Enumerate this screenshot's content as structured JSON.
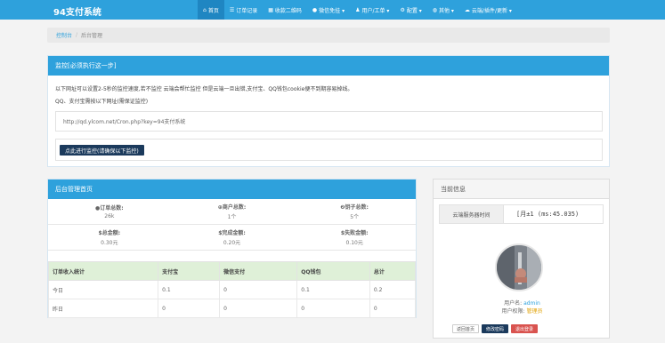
{
  "app": {
    "title": "94支付系统"
  },
  "nav": [
    {
      "icon": "home-icon",
      "glyph": "⌂",
      "label": "首页"
    },
    {
      "icon": "list-icon",
      "glyph": "☰",
      "label": "订单记录"
    },
    {
      "icon": "qrcode-icon",
      "glyph": "▦",
      "label": "收款二维码"
    },
    {
      "icon": "wechat-icon",
      "glyph": "●",
      "label": "微信免挂 ▾"
    },
    {
      "icon": "user-icon",
      "glyph": "♟",
      "label": "用户/工单 ▾"
    },
    {
      "icon": "gear-icon",
      "glyph": "⚙",
      "label": "配置 ▾"
    },
    {
      "icon": "globe-icon",
      "glyph": "◍",
      "label": "其他 ▾"
    },
    {
      "icon": "cloud-icon",
      "glyph": "☁",
      "label": "云端/插件/更新 ▾"
    }
  ],
  "breadcrumb": {
    "home": "控制台",
    "sep": "/",
    "current": "后台管理"
  },
  "monitor": {
    "title": "监控[必须执行这一步]",
    "line1": "以下网址可以设置2-5秒的监控速度,若不监控 云端会帮忙监控 但是云端一旦出错,支付宝、QQ钱包cookie便不到期容易掉线。",
    "line2": "QQ、支付宝需按以下网址(需保证监控)",
    "url": "http://qd.ylcom.net/Cron.php?key=94支付系统",
    "button": "点此进行监控(请确保以下监控)"
  },
  "stats": {
    "title": "后台管理首页",
    "items": [
      {
        "label": "订单总数:",
        "icon": "●",
        "value": "26k"
      },
      {
        "label": "商户总数:",
        "icon": "⊕",
        "value": "1个"
      },
      {
        "label": "钥子总数:",
        "icon": "❷",
        "value": "5个"
      },
      {
        "label": "$总金额:",
        "icon": "",
        "value": "0.30元"
      },
      {
        "label": "$完成金额:",
        "icon": "",
        "value": "0.20元"
      },
      {
        "label": "$失败金额:",
        "icon": "",
        "value": "0.10元"
      }
    ]
  },
  "income": {
    "headers": [
      "订单收入统计",
      "支付宝",
      "微信支付",
      "QQ钱包",
      "总计"
    ],
    "rows": [
      [
        "今日",
        "0.1",
        "0",
        "0.1",
        "0.2"
      ],
      [
        "昨日",
        "0",
        "0",
        "0",
        "0"
      ]
    ]
  },
  "sysinfo": {
    "title": "当前信息",
    "time_label": "云端服务器时间",
    "time_value": "[月±1 (ms:45.035)"
  },
  "user": {
    "name_label": "用户名:",
    "name": "admin",
    "role_label": "用户权限:",
    "role": "管理员",
    "btn_home": "返回首页",
    "btn_password": "修改密码",
    "btn_logout": "退出登录"
  }
}
